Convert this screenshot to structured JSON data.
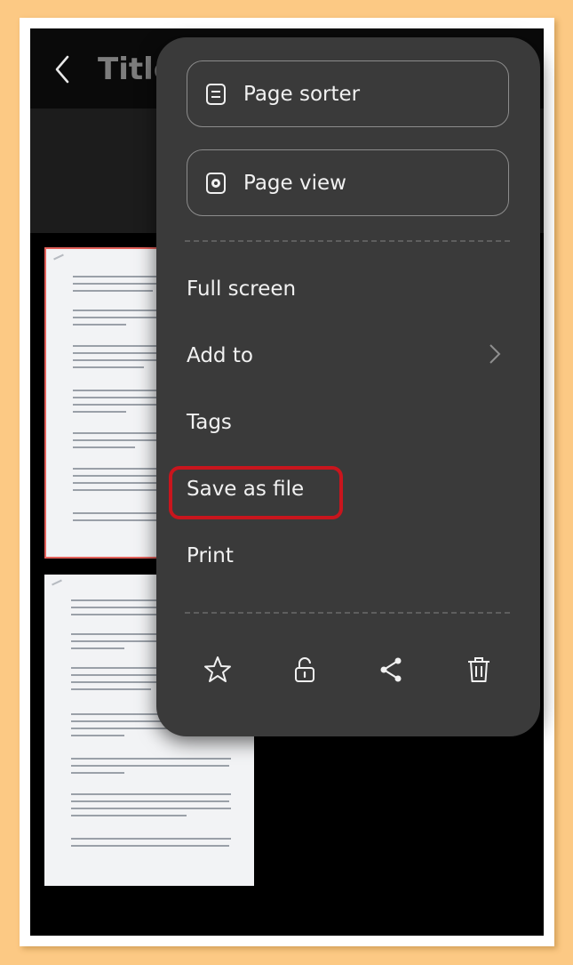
{
  "header": {
    "title": "Title"
  },
  "menu": {
    "page_sorter": "Page sorter",
    "page_view": "Page view",
    "full_screen": "Full screen",
    "add_to": "Add to",
    "tags": "Tags",
    "save_as_file": "Save as file",
    "print": "Print"
  },
  "icons": {
    "back": "back-arrow-icon",
    "page_sorter": "page-sorter-icon",
    "page_view": "page-view-icon",
    "add_to_chevron": "chevron-right-icon",
    "favorite": "star-icon",
    "lock": "unlock-icon",
    "share": "share-icon",
    "delete": "trash-icon"
  },
  "colors": {
    "highlight": "#c9151d",
    "menu_bg": "#3a3a3a",
    "selected_page_border": "#e2605a",
    "outer_bg": "#fcc984"
  }
}
